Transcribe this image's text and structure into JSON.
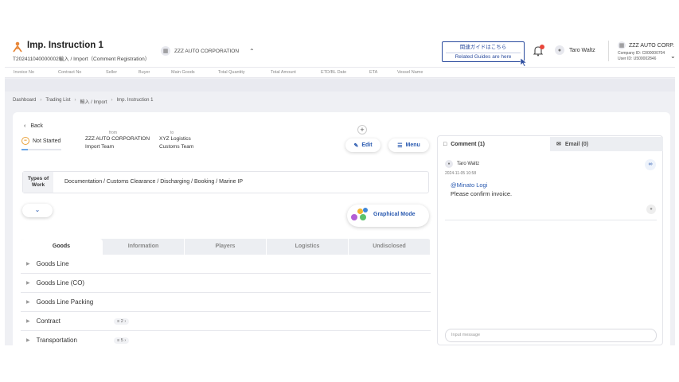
{
  "header": {
    "title": "Imp. Instruction 1",
    "subtitle": "T202411040000002輸入 / Import（Comment Registration）",
    "corporation": "ZZZ AUTO CORPORATION",
    "guide": {
      "jp": "関連ガイドはこちら",
      "en": "Related Guides are here"
    },
    "user": "Taro Waltz",
    "company": {
      "name": "ZZZ AUTO CORP.",
      "company_id": "Company ID: C000000704",
      "user_id": "User ID: U500002846"
    }
  },
  "columns": [
    "Invoice No",
    "Contract No",
    "Seller",
    "Buyer",
    "Main Goods",
    "Total Quantity",
    "Total Amount",
    "ETD/BL Date",
    "ETA",
    "Vessel Name"
  ],
  "breadcrumb": [
    "Dashboard",
    "Trading List",
    "輸入 / Import",
    "Imp. Instruction 1"
  ],
  "detail": {
    "back": "Back",
    "status": "Not Started",
    "from_label": "from",
    "from_name": "ZZZ AUTO CORPORATION",
    "from_team": "Import Team",
    "to_label": "to",
    "to_name": "XYZ Logistics",
    "to_team": "Customs Team",
    "edit": "Edit",
    "menu": "Menu",
    "work_label": "Types of Work",
    "work_value": "Documentation / Customs Clearance / Discharging / Booking / Marine IP",
    "graphical": "Graphical Mode"
  },
  "tabs": [
    "Goods",
    "Information",
    "Players",
    "Logistics",
    "Undisclosed"
  ],
  "rows": [
    {
      "label": "Goods Line",
      "badge": ""
    },
    {
      "label": "Goods Line (CO)",
      "badge": ""
    },
    {
      "label": "Goods Line Packing",
      "badge": ""
    },
    {
      "label": "Contract",
      "badge": "≡ 2 ›"
    },
    {
      "label": "Transportation",
      "badge": "≡ 5 ›"
    }
  ],
  "comments": {
    "tab_comment": "Comment (1)",
    "tab_email": "Email (0)",
    "author": "Taro Waltz",
    "time": "2024-11-05 10:58",
    "mention": "@Minato Logi",
    "text": "Please confirm invoice.",
    "input_placeholder": "Input message"
  },
  "colors": {
    "accent": "#2a5ab0",
    "guide_border": "#2a4b9e",
    "status_orange": "#e9a23b",
    "notification": "#e8463a"
  }
}
